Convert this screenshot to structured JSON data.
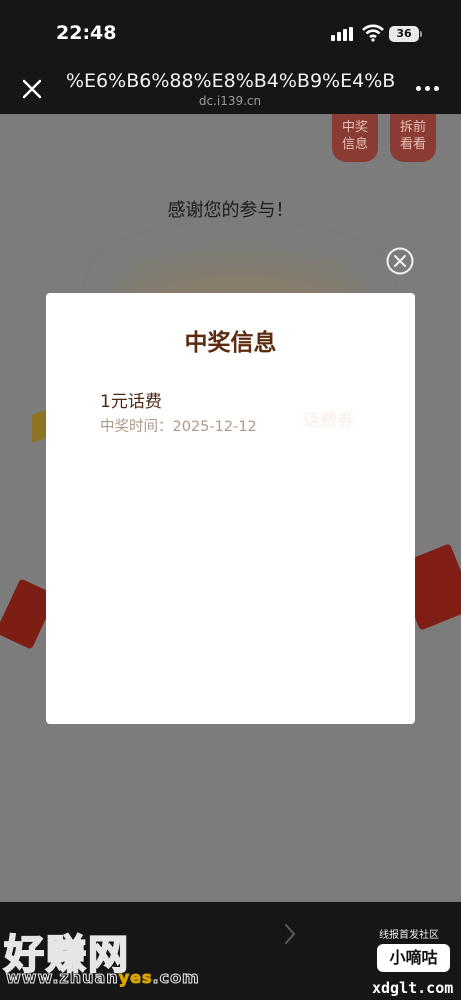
{
  "status_bar": {
    "time": "22:48",
    "battery": "36"
  },
  "nav": {
    "title": "%E6%B6%88%E8%B4%B9%E4%B",
    "domain": "dc.i139.cn"
  },
  "page": {
    "side_buttons": [
      "中奖\n信息",
      "拆前\n看看"
    ],
    "thanks_text": "感谢您的参与！"
  },
  "modal": {
    "title": "中奖信息",
    "prize_name": "1元话费",
    "time_label": "中奖时间：",
    "time_value": "2025-12-12",
    "ghost_text": "话费券"
  },
  "watermark": {
    "logo": "好赚网",
    "url_prefix": "www.zhuan",
    "url_highlight": "yes",
    "url_suffix": ".com",
    "community": "线报首发社区",
    "badge": "小嘀咕",
    "site": "xdglt.com"
  }
}
